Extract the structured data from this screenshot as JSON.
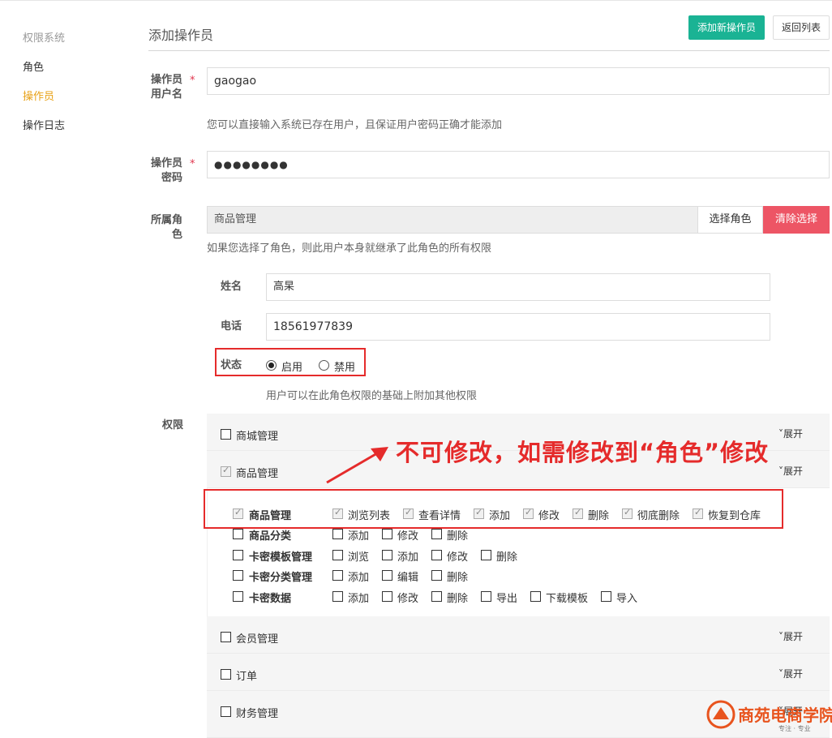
{
  "sidebar": {
    "heading": "权限系统",
    "items": [
      {
        "label": "角色"
      },
      {
        "label": "操作员"
      },
      {
        "label": "操作日志"
      }
    ]
  },
  "header": {
    "title": "添加操作员",
    "add_button": "添加新操作员",
    "back_button": "返回列表"
  },
  "form": {
    "username": {
      "label_line1": "操作员",
      "label_line2": "用户名",
      "required": "*",
      "value": "gaogao",
      "help": "您可以直接输入系统已存在用户，且保证用户密码正确才能添加"
    },
    "password": {
      "label_line1": "操作员",
      "label_line2": "密码",
      "required": "*",
      "value": "●●●●●●●●"
    },
    "role": {
      "label_line1": "所属角",
      "label_line2": "色",
      "value": "商品管理",
      "select_button": "选择角色",
      "clear_button": "清除选择",
      "help": "如果您选择了角色，则此用户本身就继承了此角色的所有权限"
    },
    "name": {
      "label": "姓名",
      "value": "高杲"
    },
    "phone": {
      "label": "电话",
      "value": "18561977839"
    },
    "status": {
      "label": "状态",
      "options": [
        "启用",
        "禁用"
      ],
      "selected": "启用"
    },
    "extra_help": "用户可以在此角色权限的基础上附加其他权限",
    "permissions_label": "权限"
  },
  "permissions": {
    "expand_label": "展开",
    "groups": [
      {
        "name": "商城管理",
        "checked": false
      },
      {
        "name": "商品管理",
        "checked": true
      },
      {
        "name": "会员管理",
        "checked": false
      },
      {
        "name": "订单",
        "checked": false
      },
      {
        "name": "财务管理",
        "checked": false
      }
    ],
    "rows": [
      {
        "name": "商品管理",
        "checked": true,
        "actions": [
          "浏览列表",
          "查看详情",
          "添加",
          "修改",
          "删除",
          "彻底删除",
          "恢复到仓库"
        ]
      },
      {
        "name": "商品分类",
        "checked": false,
        "actions": [
          "添加",
          "修改",
          "删除"
        ]
      },
      {
        "name": "卡密模板管理",
        "checked": false,
        "actions": [
          "浏览",
          "添加",
          "修改",
          "删除"
        ]
      },
      {
        "name": "卡密分类管理",
        "checked": false,
        "actions": [
          "添加",
          "编辑",
          "删除"
        ]
      },
      {
        "name": "卡密数据",
        "checked": false,
        "actions": [
          "添加",
          "修改",
          "删除",
          "导出",
          "下载模板",
          "导入"
        ]
      }
    ]
  },
  "annotation": "不可修改，如需修改到“角色”修改",
  "logo": {
    "text": "商苑电商学院",
    "sub": "专注 · 专业"
  },
  "colors": {
    "primary": "#1ab394",
    "danger": "#ed5565",
    "active": "#e8a117",
    "annotation": "#e52b2b"
  }
}
